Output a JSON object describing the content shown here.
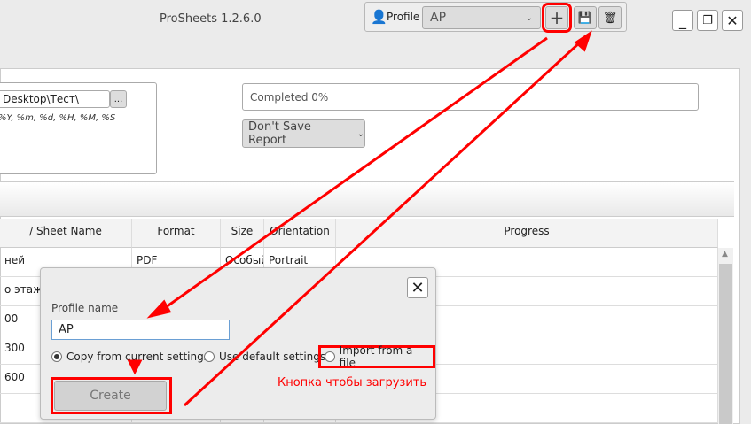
{
  "app": {
    "title": "ProSheets 1.2.6.0"
  },
  "profile": {
    "label": "Profile",
    "selected": "AP"
  },
  "folder": {
    "path": "Desktop\\Тест\\",
    "browse": "...",
    "hint": "%Y, %m, %d, %H, %M, %S"
  },
  "status": {
    "progress_text": "Completed 0%",
    "progress": 0,
    "report_option": "Don't Save Report"
  },
  "table": {
    "headers": [
      "/ Sheet Name",
      "Format",
      "Size",
      "Orientation",
      "Progress"
    ],
    "rows": [
      [
        "ней",
        "PDF",
        "Особый",
        "Portrait"
      ],
      [
        "о этажа",
        "",
        "",
        ""
      ],
      [
        "00",
        "",
        "",
        ""
      ],
      [
        "300",
        "",
        "",
        ""
      ],
      [
        "600",
        "",
        "",
        ""
      ],
      [
        "",
        "",
        "",
        ""
      ]
    ]
  },
  "dialog": {
    "profile_name_label": "Profile name",
    "profile_name_value": "AP",
    "options": [
      "Copy from current settings",
      "Use default settings",
      "Import from a file"
    ],
    "selected_option": 0,
    "create": "Create",
    "annotation": "Кнопка чтобы загрузить"
  },
  "colors": {
    "annotation": "#ff0000"
  }
}
